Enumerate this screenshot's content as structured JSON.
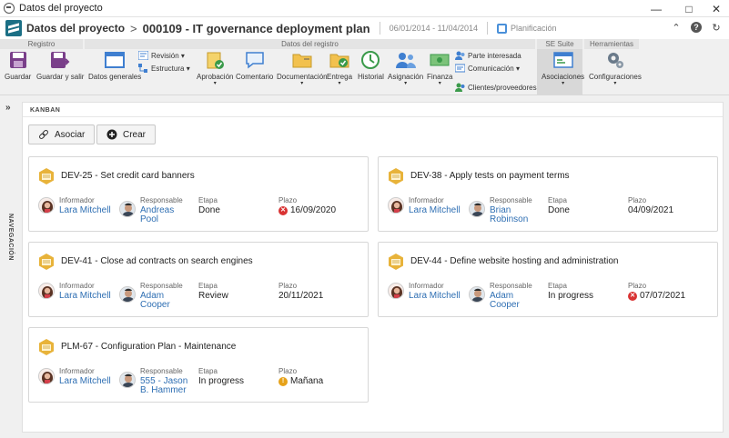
{
  "window": {
    "title": "Datos del proyecto"
  },
  "header": {
    "title": "Datos del proyecto",
    "separator": ">",
    "project": "000109 - IT governance deployment plan",
    "dates": "06/01/2014 - 11/04/2014",
    "phase": "Planificación"
  },
  "ribbon": {
    "groups": [
      "Registro",
      "Datos del registro",
      "SE Suite",
      "Herramientas"
    ],
    "buttons": {
      "guardar": "Guardar",
      "guardar_salir": "Guardar y salir",
      "datos_generales": "Datos generales",
      "revision": "Revisión",
      "estructura": "Estructura",
      "aprobacion": "Aprobación",
      "comentario": "Comentario",
      "documentacion": "Documentación",
      "entrega": "Entrega",
      "historial": "Historial",
      "asignacion": "Asignación",
      "finanza": "Finanza",
      "parte_interesada": "Parte interesada",
      "comunicacion": "Comunicación",
      "clientes": "Clientes/proveedores",
      "asociaciones": "Asociaciones",
      "configuraciones": "Configuraciones"
    },
    "colors": {
      "save_purple": "#7a3f8a",
      "accent_blue": "#3f7fd0",
      "green": "#3a9a4a"
    }
  },
  "nav": {
    "label": "NAVEGACIÓN"
  },
  "kanban": {
    "title": "KANBAN",
    "associate_label": "Asociar",
    "create_label": "Crear",
    "field_labels": {
      "reporter": "Informador",
      "responsible": "Responsable",
      "stage": "Etapa",
      "due": "Plazo"
    },
    "cards": [
      {
        "title": "DEV-25 - Set credit card banners",
        "reporter": "Lara Mitchell",
        "responsible_1": "Andreas",
        "responsible_2": "Pool",
        "stage": "Done",
        "due": "16/09/2020",
        "due_status": "overdue"
      },
      {
        "title": "DEV-38 - Apply tests on payment terms",
        "reporter": "Lara Mitchell",
        "responsible_1": "Brian",
        "responsible_2": "Robinson",
        "stage": "Done",
        "due": "04/09/2021",
        "due_status": "none"
      },
      {
        "title": "DEV-41 - Close ad contracts on search engines",
        "reporter": "Lara Mitchell",
        "responsible_1": "Adam",
        "responsible_2": "Cooper",
        "stage": "Review",
        "due": "20/11/2021",
        "due_status": "none"
      },
      {
        "title": "DEV-44 - Define website hosting and administration",
        "reporter": "Lara Mitchell",
        "responsible_1": "Adam",
        "responsible_2": "Cooper",
        "stage": "In progress",
        "due": "07/07/2021",
        "due_status": "overdue"
      },
      {
        "title": "PLM-67 - Configuration Plan - Maintenance",
        "reporter": "Lara Mitchell",
        "responsible_1": "555 - Jason",
        "responsible_2": "B. Hammer",
        "stage": "In progress",
        "due": "Mañana",
        "due_status": "warning"
      }
    ]
  }
}
